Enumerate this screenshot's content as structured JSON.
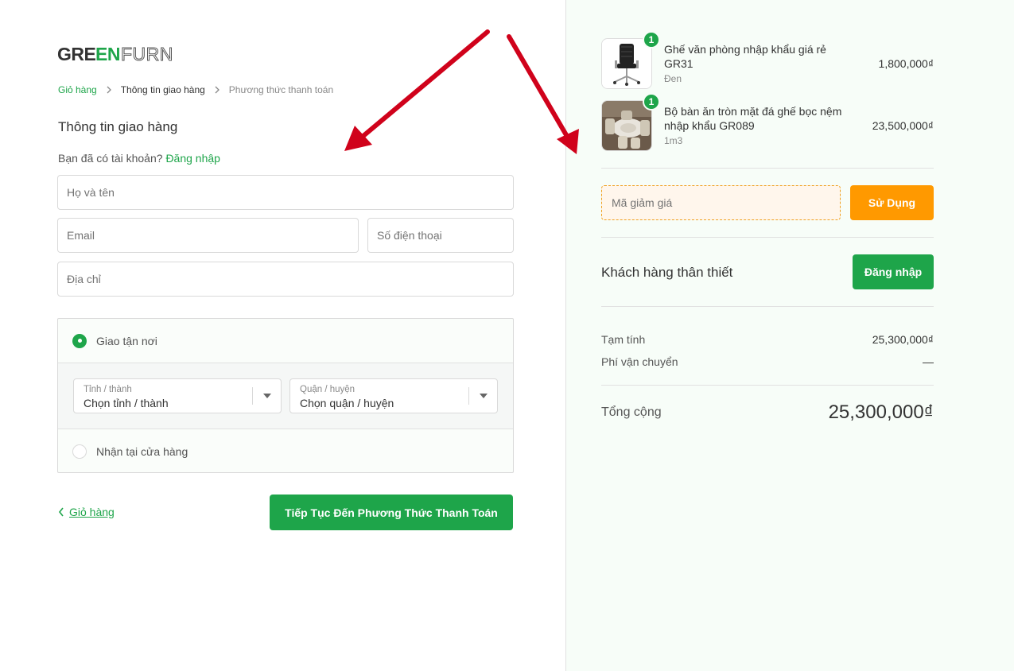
{
  "brand": {
    "logo_text": "GREENFURNi",
    "accent": "#1ea54a",
    "orange": "#ff9900"
  },
  "breadcrumb": [
    {
      "label": "Giỏ hàng"
    },
    {
      "label": "Thông tin giao hàng"
    },
    {
      "label": "Phương thức thanh toán"
    }
  ],
  "shipping": {
    "title": "Thông tin giao hàng",
    "login_prompt": "Bạn đã có tài khoản?",
    "login_link": "Đăng nhập",
    "fullname_placeholder": "Họ và tên",
    "email_placeholder": "Email",
    "phone_placeholder": "Số điện thoại",
    "address_placeholder": "Địa chỉ"
  },
  "delivery": {
    "option_home": "Giao tận nơi",
    "option_store": "Nhận tại cửa hàng",
    "province_label": "Tỉnh / thành",
    "province_value": "Chọn tỉnh / thành",
    "district_label": "Quận / huyện",
    "district_value": "Chọn quận / huyện"
  },
  "actions": {
    "back_label": "Giỏ hàng",
    "continue_label": "Tiếp Tục Đến Phương Thức Thanh Toán"
  },
  "order": {
    "products": [
      {
        "qty": "1",
        "name": "Ghế văn phòng nhập khẩu giá rẻ GR31",
        "variant": "Đen",
        "price": "1,800,000₫"
      },
      {
        "qty": "1",
        "name": "Bộ bàn ăn tròn mặt đá ghế bọc nệm nhập khẩu GR089",
        "variant": "1m3",
        "price": "23,500,000₫"
      }
    ],
    "discount_placeholder": "Mã giảm giá",
    "apply_label": "Sử Dụng",
    "loyal_label": "Khách hàng thân thiết",
    "loyal_button": "Đăng nhập",
    "subtotal_label": "Tạm tính",
    "subtotal_value": "25,300,000₫",
    "shipping_label": "Phí vận chuyển",
    "shipping_value": "—",
    "total_label": "Tổng cộng",
    "total_value": "25,300,000₫"
  }
}
